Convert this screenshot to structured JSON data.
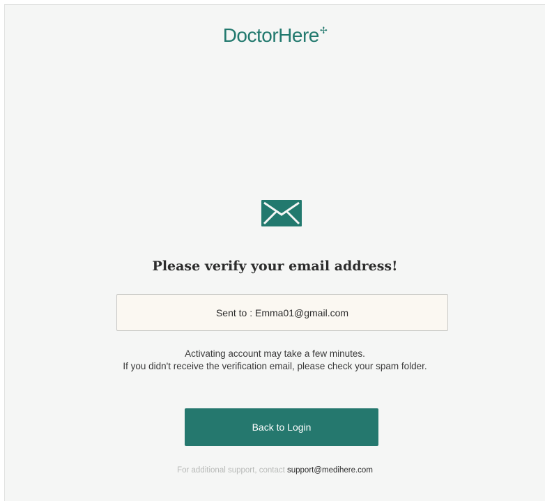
{
  "brand": {
    "name": "DoctorHere",
    "mark": "✢",
    "color": "#22796e"
  },
  "icon": "mail-icon",
  "heading": "Please verify your email address!",
  "sent": {
    "text": "Sent to : Emma01@gmail.com"
  },
  "info": {
    "line1": "Activating account may take a few minutes.",
    "line2": "If you didn't receive the verification email, please check your spam folder."
  },
  "button": {
    "label": "Back to Login",
    "color": "#25786e"
  },
  "support": {
    "prefix": "For additional support, contact ",
    "email": "support@medihere.com"
  }
}
